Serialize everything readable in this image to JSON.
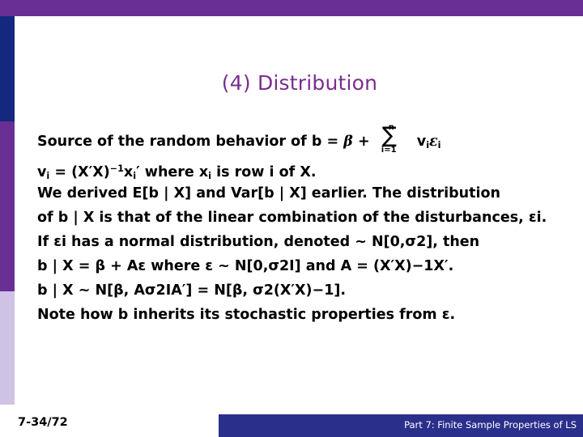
{
  "slide": {
    "title": "(4)  Distribution",
    "title_color": "#7a2e8e",
    "accent_purple": "#6a2f95",
    "accent_blue": "#14287d",
    "accent_lavender": "#cfc2e4",
    "footer_bar_color": "#2b2f8c"
  },
  "body": {
    "line1_a": "Source of the random behavior of ",
    "line1_b": "b",
    "line1_c": " = ",
    "line1_beta": "β",
    "line1_plus": " + ",
    "line1_sum_top": "n",
    "line1_sum_bot": "i=1",
    "line1_v": "v",
    "line1_vsub": "i",
    "line1_eps": "ε",
    "line1_epssub": "i",
    "line2_v": "v",
    "line2_vsub": "i",
    "line2_eq": " = (",
    "line2_X1": "X",
    "line2_prime1": "′",
    "line2_X2": "X",
    "line2_close": ")",
    "line2_pow": "−1",
    "line2_x": "x",
    "line2_xsub": "i",
    "line2_prime2": "′",
    "line2_where": "  where   ",
    "line2_x2": "x",
    "line2_x2sub": "i",
    "line2_isrow": " is row ",
    "line2_i": "i",
    "line2_of": " of ",
    "line2_X3": "X",
    "line2_dot": ".",
    "line3": "We derived E[b | X] and Var[b | X] earlier.  The distribution",
    "line4": "of b | X is that of the linear combination of the disturbances, εi.",
    "line5": "If εi has a normal distribution, denoted ~ N[0,σ2], then",
    "line6": "b | X  =   β +  Aε where ε  ~  N[0,σ2I] and A  =  (X′X)−1X′.",
    "line7": "b | X   ~   N[β, Aσ2IA′] =  N[β, σ2(X′X)−1].",
    "line8": "Note how b inherits its stochastic properties from ε."
  },
  "footer": {
    "page_number": "7-34/72",
    "caption": "Part 7: Finite Sample Properties of LS"
  }
}
